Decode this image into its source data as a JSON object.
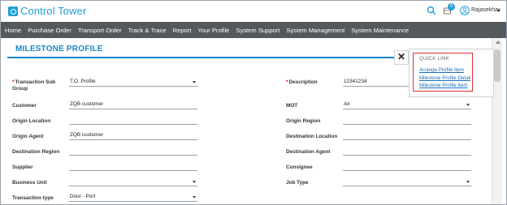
{
  "app": {
    "brand": "Control Tower"
  },
  "header": {
    "notification_count": "0",
    "user_name": "Rajasekhar"
  },
  "nav": {
    "items": [
      "Home",
      "Purchase Order",
      "Transport Order",
      "Track & Trace",
      "Report",
      "Your Profile",
      "System Support",
      "System Management",
      "System Maintenance"
    ]
  },
  "page": {
    "title": "MILESTONE PROFILE"
  },
  "form": {
    "transaction_sub_group": {
      "label_line1": "Transaction Sub",
      "label_line2": "Group",
      "value": "T.O. Profile"
    },
    "description": {
      "label": "Description",
      "value": "12341234"
    },
    "customer": {
      "label": "Customer",
      "value": "ZQB customer"
    },
    "mot": {
      "label": "MOT",
      "value": "Air"
    },
    "origin_location": {
      "label": "Origin Location",
      "value": ""
    },
    "origin_region": {
      "label": "Origin Region",
      "value": ""
    },
    "origin_agent": {
      "label": "Origin Agent",
      "value": "ZQB customer"
    },
    "destination_location": {
      "label": "Destination Location",
      "value": ""
    },
    "destination_region": {
      "label": "Destination Region",
      "value": ""
    },
    "destination_agent": {
      "label": "Destination Agent",
      "value": ""
    },
    "supplier": {
      "label": "Supplier",
      "value": ""
    },
    "consignee": {
      "label": "Consignee",
      "value": ""
    },
    "business_unit": {
      "label": "Business Unit",
      "value": ""
    },
    "job_type": {
      "label": "Job Type",
      "value": ""
    },
    "transaction_type": {
      "label": "Transaction type",
      "value": "Door - Port"
    }
  },
  "quick_link": {
    "close_symbol": "✕",
    "title": "QUICK LINK",
    "links": [
      "Arrange Profile Item",
      "Milestone Profile Detail",
      "Milestone Profile Item"
    ]
  },
  "colors": {
    "brand": "#1e9fd8",
    "nav_bg": "#54595e",
    "title": "#1a85c8",
    "required": "#d0021b",
    "highlight_border": "#e03030"
  },
  "icons": [
    "search-icon",
    "bell-icon",
    "user-icon",
    "chevron-down-icon",
    "close-icon"
  ]
}
